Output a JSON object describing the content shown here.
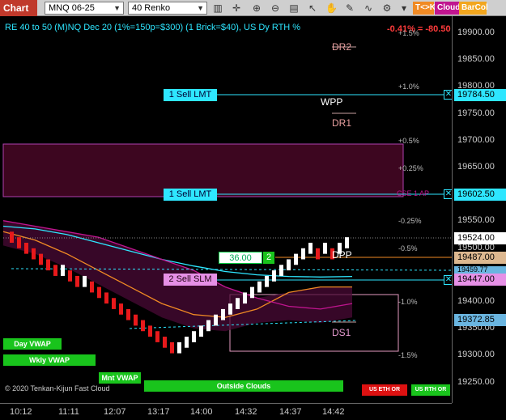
{
  "toolbar": {
    "chart_tab": "Chart",
    "instrument": "MNQ 06-25",
    "period": "40 Renko",
    "tck_label": "T<>K",
    "cloud_label": "Cloud",
    "barcol_label": "BarCol",
    "icons": [
      "bar-type-icon",
      "crosshair-icon",
      "zoom-in-icon",
      "zoom-out-icon",
      "properties-icon",
      "cursor-icon",
      "hand-icon",
      "draw-icon",
      "indicator-icon",
      "strategy-icon"
    ]
  },
  "chart": {
    "title": "RE 40 to 50 (M)NQ Dec 20 (1%=150p=$300) (1 Brick=$40), US Dy RTH %",
    "change": "-0.41% = -80.50",
    "pct_labels": [
      "+1.5%",
      "+1.0%",
      "+0.5%",
      "+0.25%",
      "-0.25%",
      "-0.5%",
      "-1.0%",
      "-1.5%"
    ],
    "levels": {
      "dr2": "DR2",
      "wpp": "WPP",
      "dr1": "DR1",
      "dpp": "DPP",
      "ds1": "DS1",
      "cse": "CSE 1 AP"
    },
    "orders": [
      {
        "label": "1 Sell LMT",
        "price": "19784.50"
      },
      {
        "label": "1 Sell LMT",
        "price": "19602.50"
      },
      {
        "label": "2 Sell SLM",
        "price": "19447.00"
      }
    ],
    "position": {
      "value": "36.00",
      "qty": "2"
    },
    "buttons": {
      "day_vwap": "Day VWAP",
      "wkly_vwap": "Wkly VWAP",
      "mnt_vwap": "Mnt VWAP",
      "outside_clouds": "Outside Clouds",
      "us_eth_or": "US ETH OR",
      "us_rth_or": "US RTH OR"
    },
    "copyright": "© 2020 Tenkan-Kijun Fast Cloud"
  },
  "price_axis": {
    "ticks": [
      "19900.00",
      "19850.00",
      "19800.00",
      "19750.00",
      "19700.00",
      "19650.00",
      "19600.00",
      "19550.00",
      "19500.00",
      "19450.00",
      "19400.00",
      "19350.00",
      "19300.00",
      "19250.00"
    ],
    "last_price": "19524.00",
    "tag_19487": "19487.00",
    "tag_19459": "19459.77",
    "tag_19372": "19372.85"
  },
  "time_axis": {
    "ticks": [
      "10:12",
      "11:11",
      "12:07",
      "13:17",
      "14:00",
      "14:32",
      "14:37",
      "14:42"
    ]
  },
  "chart_data": {
    "type": "renko",
    "instrument": "MNQ 06-25",
    "brick_size": 40,
    "last_price": 19524.0,
    "ylim": [
      19230,
      19930
    ],
    "x_ticks": [
      "10:12",
      "11:11",
      "12:07",
      "13:17",
      "14:00",
      "14:32",
      "14:37",
      "14:42"
    ],
    "bricks": [
      {
        "dir": "down",
        "open": 19540,
        "close": 19520
      },
      {
        "dir": "down",
        "open": 19530,
        "close": 19510
      },
      {
        "dir": "down",
        "open": 19520,
        "close": 19500
      },
      {
        "dir": "down",
        "open": 19510,
        "close": 19490
      },
      {
        "dir": "down",
        "open": 19500,
        "close": 19480
      },
      {
        "dir": "down",
        "open": 19490,
        "close": 19470
      },
      {
        "dir": "down",
        "open": 19480,
        "close": 19460
      },
      {
        "dir": "up",
        "open": 19460,
        "close": 19480
      },
      {
        "dir": "down",
        "open": 19470,
        "close": 19450
      },
      {
        "dir": "down",
        "open": 19460,
        "close": 19440
      },
      {
        "dir": "up",
        "open": 19440,
        "close": 19460
      },
      {
        "dir": "down",
        "open": 19450,
        "close": 19430
      },
      {
        "dir": "down",
        "open": 19440,
        "close": 19420
      },
      {
        "dir": "down",
        "open": 19430,
        "close": 19410
      },
      {
        "dir": "down",
        "open": 19420,
        "close": 19400
      },
      {
        "dir": "down",
        "open": 19410,
        "close": 19390
      },
      {
        "dir": "down",
        "open": 19400,
        "close": 19380
      },
      {
        "dir": "down",
        "open": 19390,
        "close": 19370
      },
      {
        "dir": "down",
        "open": 19380,
        "close": 19360
      },
      {
        "dir": "down",
        "open": 19370,
        "close": 19350
      },
      {
        "dir": "down",
        "open": 19360,
        "close": 19340
      },
      {
        "dir": "down",
        "open": 19350,
        "close": 19330
      },
      {
        "dir": "down",
        "open": 19340,
        "close": 19320
      },
      {
        "dir": "up",
        "open": 19320,
        "close": 19340
      },
      {
        "dir": "up",
        "open": 19330,
        "close": 19350
      },
      {
        "dir": "up",
        "open": 19340,
        "close": 19360
      },
      {
        "dir": "up",
        "open": 19350,
        "close": 19370
      },
      {
        "dir": "up",
        "open": 19360,
        "close": 19380
      },
      {
        "dir": "up",
        "open": 19370,
        "close": 19390
      },
      {
        "dir": "up",
        "open": 19380,
        "close": 19400
      },
      {
        "dir": "up",
        "open": 19390,
        "close": 19410
      },
      {
        "dir": "up",
        "open": 19400,
        "close": 19420
      },
      {
        "dir": "up",
        "open": 19410,
        "close": 19430
      },
      {
        "dir": "up",
        "open": 19420,
        "close": 19440
      },
      {
        "dir": "up",
        "open": 19430,
        "close": 19450
      },
      {
        "dir": "up",
        "open": 19440,
        "close": 19460
      },
      {
        "dir": "up",
        "open": 19450,
        "close": 19470
      },
      {
        "dir": "up",
        "open": 19460,
        "close": 19480
      },
      {
        "dir": "up",
        "open": 19470,
        "close": 19490
      },
      {
        "dir": "up",
        "open": 19480,
        "close": 19500
      },
      {
        "dir": "up",
        "open": 19490,
        "close": 19510
      },
      {
        "dir": "up",
        "open": 19500,
        "close": 19520
      },
      {
        "dir": "down",
        "open": 19510,
        "close": 19490
      },
      {
        "dir": "up",
        "open": 19500,
        "close": 19520
      },
      {
        "dir": "down",
        "open": 19510,
        "close": 19490
      },
      {
        "dir": "up",
        "open": 19500,
        "close": 19520
      },
      {
        "dir": "up",
        "open": 19510,
        "close": 19530
      }
    ],
    "lines": [
      {
        "name": "cyan",
        "color": "#2ee6ff",
        "points": [
          19550,
          19545,
          19535,
          19520,
          19505,
          19490,
          19478,
          19468,
          19462,
          19459,
          19458,
          19459
        ]
      },
      {
        "name": "orange",
        "color": "#f08a24",
        "points": [
          19540,
          19525,
          19500,
          19470,
          19440,
          19410,
          19390,
          19385,
          19400,
          19430,
          19440,
          19440
        ]
      },
      {
        "name": "magenta",
        "color": "#c0158f",
        "points": [
          19560,
          19550,
          19540,
          19530,
          19510,
          19490,
          19470,
          19440,
          19420,
          19405,
          19400,
          19410
        ]
      }
    ],
    "colors": {
      "up": "#ffffff",
      "down": "#e8191b",
      "cyan": "#2ee6ff",
      "orange": "#f08a24",
      "magenta": "#c0158f"
    }
  }
}
